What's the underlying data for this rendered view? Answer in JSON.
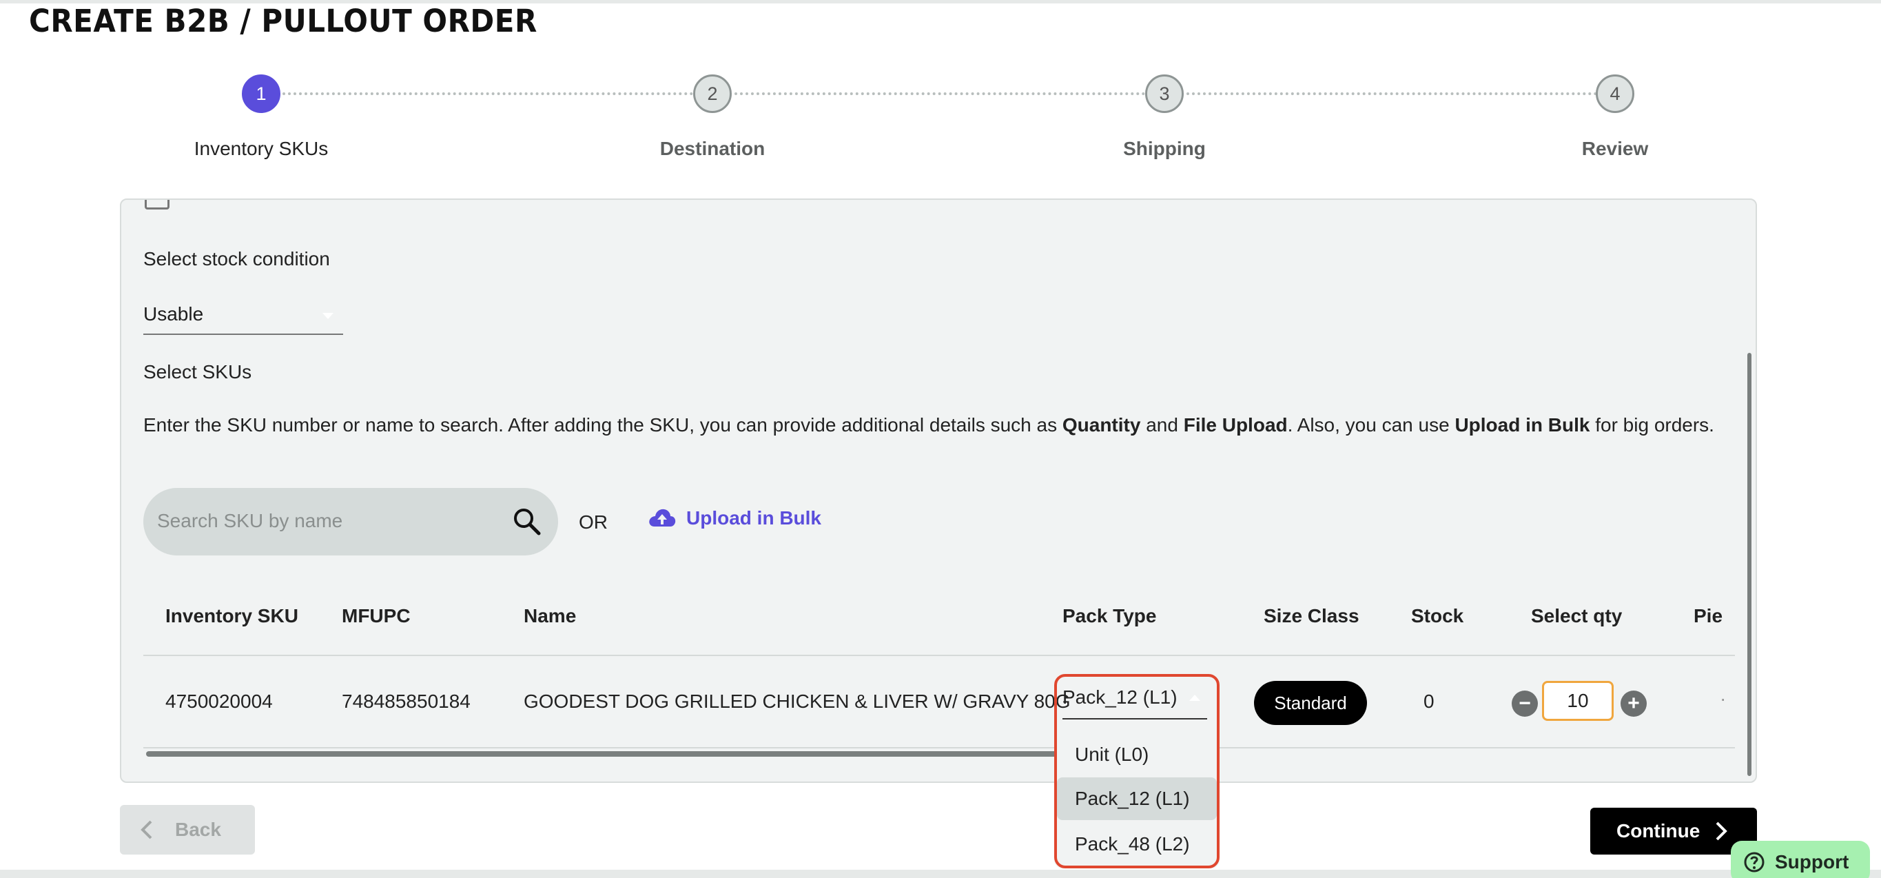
{
  "page_title": "CREATE B2B / PULLOUT ORDER",
  "stepper": {
    "steps": [
      {
        "number": "1",
        "label": "Inventory SKUs",
        "state": "active"
      },
      {
        "number": "2",
        "label": "Destination",
        "state": "todo"
      },
      {
        "number": "3",
        "label": "Shipping",
        "state": "todo"
      },
      {
        "number": "4",
        "label": "Review",
        "state": "todo"
      }
    ]
  },
  "stock_condition": {
    "label": "Select stock condition",
    "selected": "Usable"
  },
  "sku_section": {
    "label": "Select SKUs",
    "help_prefix": "Enter the SKU number or name to search. After adding the SKU, you can provide additional details such as ",
    "help_quantity": "Quantity",
    "help_and": " and ",
    "help_file_upload": "File Upload",
    "help_mid": ". Also, you can use ",
    "help_upload_bulk": "Upload in Bulk",
    "help_suffix": " for big orders.",
    "search_placeholder": "Search SKU by name",
    "or_text": "OR",
    "upload_bulk_label": "Upload in Bulk"
  },
  "table": {
    "headers": {
      "inventory_sku": "Inventory SKU",
      "mfupc": "MFUPC",
      "name": "Name",
      "pack_type": "Pack Type",
      "size_class": "Size Class",
      "stock": "Stock",
      "select_qty": "Select qty",
      "pieces": "Pie"
    },
    "row": {
      "inventory_sku": "4750020004",
      "mfupc": "748485850184",
      "name": "GOODEST DOG GRILLED CHICKEN & LIVER W/ GRAVY 80G",
      "pack_type": "Pack_12 (L1)",
      "size_class": "Standard",
      "stock": "0",
      "qty": "10",
      "pieces_partial": "·"
    }
  },
  "pack_type_dropdown": {
    "options": [
      "Unit (L0)",
      "Pack_12 (L1)",
      "Pack_48 (L2)"
    ],
    "selected_index": 1
  },
  "footer": {
    "back_label": "Back",
    "continue_label": "Continue",
    "support_label": "Support"
  },
  "colors": {
    "accent": "#5a4ddb",
    "highlight_border": "#e0472f",
    "qty_border": "#f0a63e",
    "support_bg": "#a6f0b0"
  }
}
